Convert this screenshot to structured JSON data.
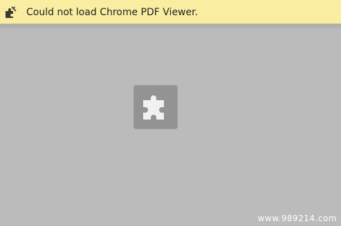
{
  "infobar": {
    "message": "Could not load Chrome PDF Viewer.",
    "icon": "plugin-warning-icon",
    "background": "#f9eda1"
  },
  "content": {
    "background": "#bbbbbb",
    "placeholder_icon": "puzzle-piece-icon",
    "placeholder_box_color": "#939393"
  },
  "watermark": {
    "text": "www.989214.com"
  }
}
